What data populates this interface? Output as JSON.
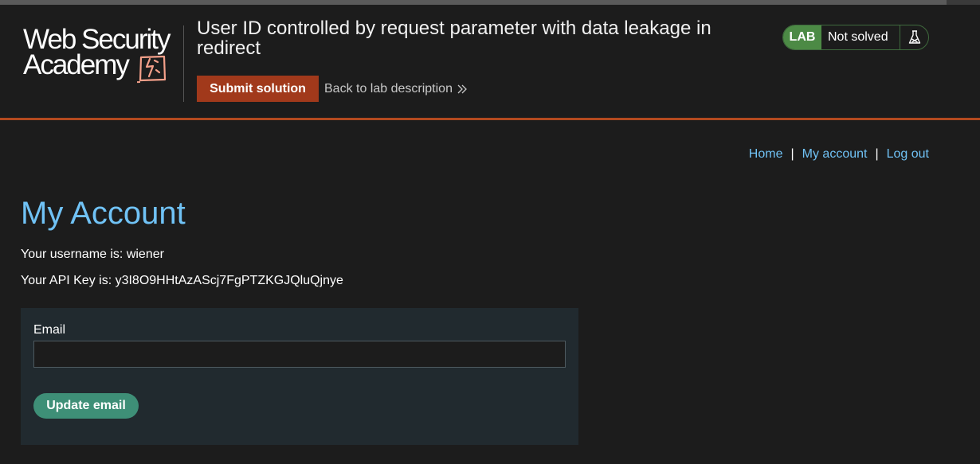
{
  "header": {
    "logo_line1": "Web Security",
    "logo_line2": "Academy",
    "lab_title": "User ID controlled by request parameter with data leakage in redirect",
    "submit_label": "Submit solution",
    "back_link_label": "Back to lab description",
    "status": {
      "tag": "LAB",
      "text": "Not solved",
      "icon": "flask-icon"
    }
  },
  "nav": {
    "home": "Home",
    "my_account": "My account",
    "log_out": "Log out",
    "separator": "|"
  },
  "main": {
    "title": "My Account",
    "username_line": "Your username is: wiener",
    "api_key_line": "Your API Key is: y3I8O9HHtAzAScj7FgPTZKGJQluQjnye",
    "form": {
      "email_label": "Email",
      "email_value": "",
      "update_label": "Update email"
    }
  },
  "colors": {
    "background": "#1c1c1c",
    "accent_orange": "#a1391b",
    "link_blue": "#70c2f5",
    "lab_green": "#4c8a45",
    "button_teal": "#3e8f77",
    "form_panel": "#212a2f"
  }
}
